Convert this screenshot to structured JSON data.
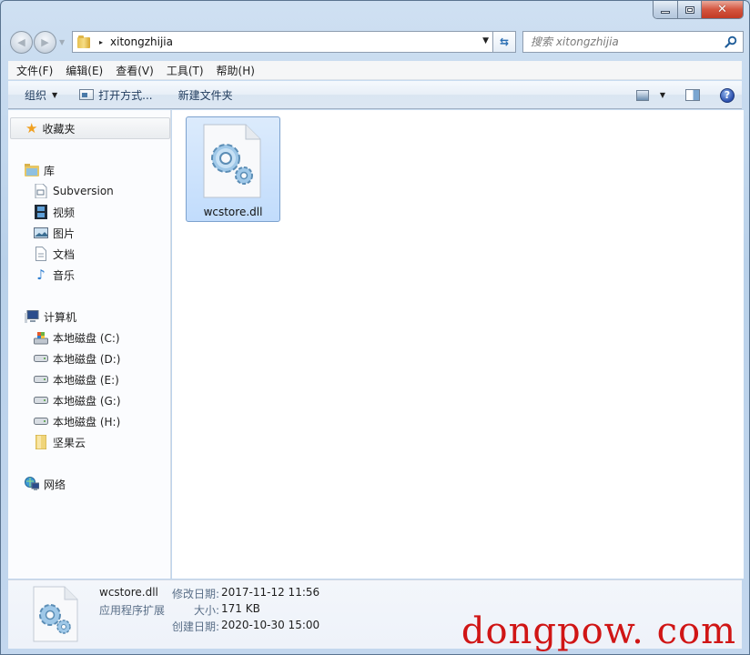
{
  "window": {
    "caption_buttons": {
      "minimize": "minimize",
      "maximize": "maximize",
      "close": "✕"
    }
  },
  "navigation": {
    "back_icon": "back-arrow-icon",
    "forward_icon": "forward-arrow-icon",
    "address": {
      "path_separator": "▸",
      "current_folder": "xitongzhijia",
      "dropdown": "▾"
    },
    "refresh_icon": "refresh-icon",
    "search": {
      "placeholder": "搜索 xitongzhijia",
      "value": ""
    }
  },
  "menubar": {
    "items": [
      "文件(F)",
      "编辑(E)",
      "查看(V)",
      "工具(T)",
      "帮助(H)"
    ]
  },
  "command_bar": {
    "organize": "组织",
    "open_with": "打开方式...",
    "new_folder": "新建文件夹",
    "help": "?"
  },
  "nav_pane": {
    "favorites": "收藏夹",
    "libraries": {
      "label": "库",
      "items": [
        "Subversion",
        "视频",
        "图片",
        "文档",
        "音乐"
      ]
    },
    "computer": {
      "label": "计算机",
      "items": [
        "本地磁盘 (C:)",
        "本地磁盘 (D:)",
        "本地磁盘 (E:)",
        "本地磁盘 (G:)",
        "本地磁盘 (H:)",
        "坚果云"
      ]
    },
    "network": "网络"
  },
  "content": {
    "files": [
      {
        "name": "wcstore.dll",
        "icon": "dll-gear-icon",
        "selected": true
      }
    ]
  },
  "details": {
    "name": "wcstore.dll",
    "type": "应用程序扩展",
    "modified_label": "修改日期:",
    "modified_value": "2017-11-12 11:56",
    "size_label": "大小:",
    "size_value": "171 KB",
    "created_label": "创建日期:",
    "created_value": "2020-10-30 15:00"
  },
  "watermark": "dongpow. com"
}
